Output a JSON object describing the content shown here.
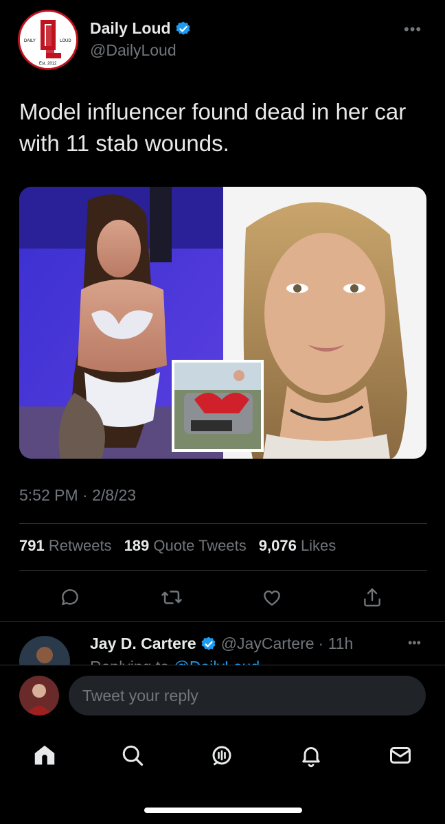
{
  "tweet": {
    "author_name": "Daily Loud",
    "author_handle": "@DailyLoud",
    "logo_text": {
      "left": "DAILY",
      "right": "LOUD",
      "bottom": "Est. 2012"
    },
    "text": "Model influencer found dead in her car with 11 stab wounds.",
    "timestamp": "5:52 PM · 2/8/23",
    "stats": {
      "retweets_count": "791",
      "retweets_label": "Retweets",
      "quotes_count": "189",
      "quotes_label": "Quote Tweets",
      "likes_count": "9,076",
      "likes_label": "Likes"
    }
  },
  "reply": {
    "author_name": "Jay D. Cartere",
    "author_handle": "@JayCartere",
    "time": "· 11h",
    "replying_prefix": "Replying to",
    "replying_handle": "@DailyLoud"
  },
  "composer": {
    "placeholder": "Tweet your reply"
  },
  "icons": {
    "actions": [
      "reply-icon",
      "retweet-icon",
      "like-icon",
      "share-icon"
    ],
    "tabbar": [
      "home-icon",
      "search-icon",
      "spaces-icon",
      "notifications-icon",
      "messages-icon"
    ]
  },
  "colors": {
    "background": "#000000",
    "accent": "#1d9bf0",
    "muted": "#71767b",
    "brand_red": "#c1121f"
  }
}
